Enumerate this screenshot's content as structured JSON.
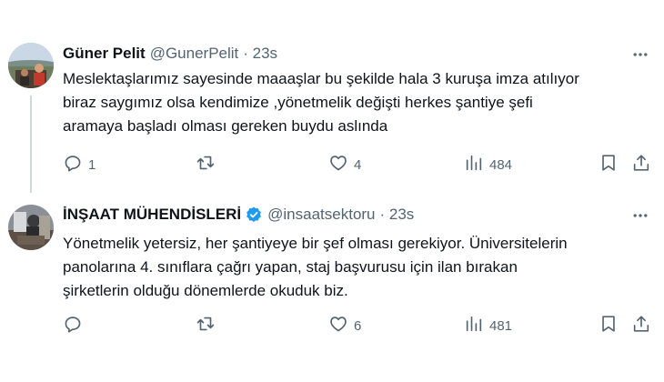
{
  "tweets": [
    {
      "name": "Güner Pelit",
      "handle": "@GunerPelit",
      "time": "· 23s",
      "text": "Meslektaşlarımız sayesinde maaaşlar bu şekilde hala 3 kuruşa imza atılıyor\nbiraz saygımız olsa kendimize ,yönetmelik değişti herkes şantiye şefi\naramaya başladı olması gereken buydu aslında",
      "replies": "1",
      "retweets": "",
      "likes": "4",
      "views": "484",
      "verified": false
    },
    {
      "name": "İNŞAAT MÜHENDİSLERİ",
      "handle": "@insaatsektoru",
      "time": "· 23s",
      "text": "Yönetmelik yetersiz, her şantiyeye bir şef olması gerekiyor. Üniversitelerin\npanolarına 4. sınıflara çağrı yapan, staj başvurusu için ilan bırakan\nşirketlerin olduğu dönemlerde okuduk biz.",
      "replies": "",
      "retweets": "",
      "likes": "6",
      "views": "481",
      "verified": true
    }
  ],
  "icons": {
    "reply": "reply-icon",
    "retweet": "retweet-icon",
    "like": "heart-icon",
    "views": "views-icon",
    "bookmark": "bookmark-icon",
    "share": "share-icon",
    "more": "more-icon",
    "verified": "verified-badge-icon"
  },
  "colors": {
    "text": "#0f1419",
    "secondary": "#536471",
    "verified": "#1d9bf0",
    "thread_line": "#cfd9de"
  }
}
